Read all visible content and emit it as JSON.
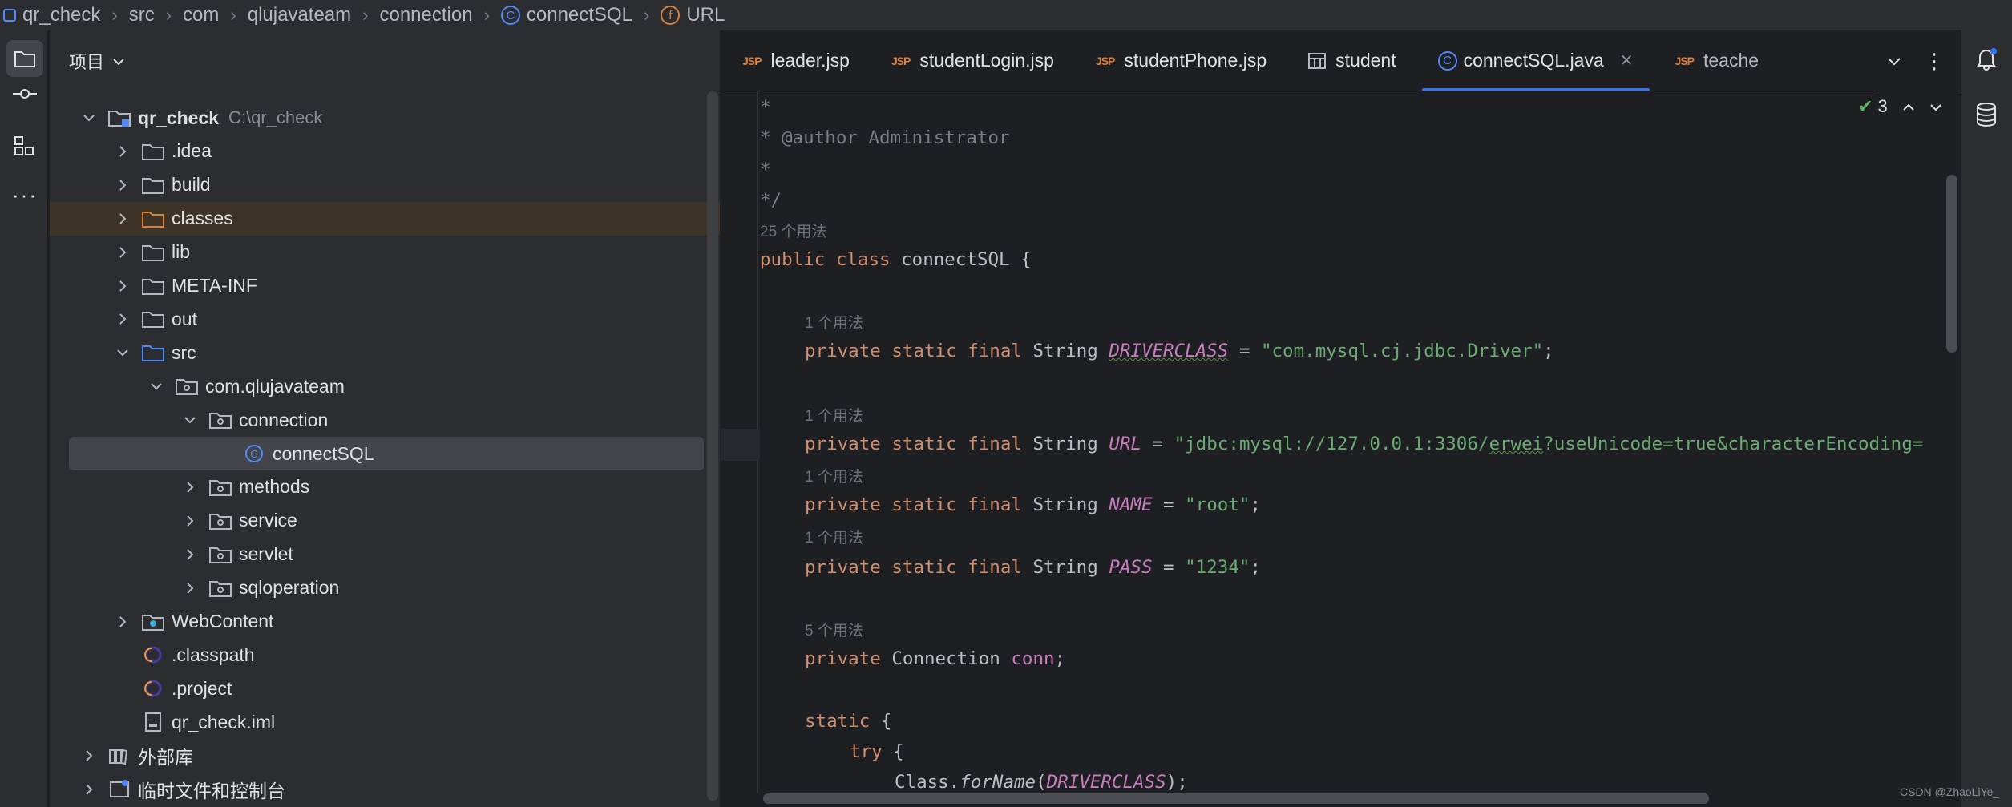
{
  "breadcrumb": [
    "qr_check",
    "src",
    "com",
    "qlujavateam",
    "connection",
    "connectSQL",
    "URL"
  ],
  "project_panel": {
    "title": "项目",
    "tree": [
      {
        "label": "qr_check",
        "sub": "C:\\qr_check",
        "depth": 0,
        "arrow": "down",
        "icon": "module-folder",
        "bold": true
      },
      {
        "label": ".idea",
        "depth": 1,
        "arrow": "right",
        "icon": "folder"
      },
      {
        "label": "build",
        "depth": 1,
        "arrow": "right",
        "icon": "folder"
      },
      {
        "label": "classes",
        "depth": 1,
        "arrow": "right",
        "icon": "folder-orange",
        "highlight": true
      },
      {
        "label": "lib",
        "depth": 1,
        "arrow": "right",
        "icon": "folder"
      },
      {
        "label": "META-INF",
        "depth": 1,
        "arrow": "right",
        "icon": "folder"
      },
      {
        "label": "out",
        "depth": 1,
        "arrow": "right",
        "icon": "folder"
      },
      {
        "label": "src",
        "depth": 1,
        "arrow": "down",
        "icon": "folder-blue"
      },
      {
        "label": "com.qlujavateam",
        "depth": 2,
        "arrow": "down",
        "icon": "package"
      },
      {
        "label": "connection",
        "depth": 3,
        "arrow": "down",
        "icon": "package"
      },
      {
        "label": "connectSQL",
        "depth": 4,
        "arrow": "none",
        "icon": "class",
        "selected": true
      },
      {
        "label": "methods",
        "depth": 3,
        "arrow": "right",
        "icon": "package"
      },
      {
        "label": "service",
        "depth": 3,
        "arrow": "right",
        "icon": "package"
      },
      {
        "label": "servlet",
        "depth": 3,
        "arrow": "right",
        "icon": "package"
      },
      {
        "label": "sqloperation",
        "depth": 3,
        "arrow": "right",
        "icon": "package"
      },
      {
        "label": "WebContent",
        "depth": 1,
        "arrow": "right",
        "icon": "web-folder"
      },
      {
        "label": ".classpath",
        "depth": 1,
        "arrow": "none",
        "icon": "eclipse"
      },
      {
        "label": ".project",
        "depth": 1,
        "arrow": "none",
        "icon": "eclipse"
      },
      {
        "label": "qr_check.iml",
        "depth": 1,
        "arrow": "none",
        "icon": "iml"
      },
      {
        "label": "外部库",
        "depth": 0,
        "arrow": "right",
        "icon": "library"
      },
      {
        "label": "临时文件和控制台",
        "depth": 0,
        "arrow": "right",
        "icon": "scratch"
      }
    ]
  },
  "tabs": [
    {
      "label": "leader.jsp",
      "icon": "JSP"
    },
    {
      "label": "studentLogin.jsp",
      "icon": "JSP"
    },
    {
      "label": "studentPhone.jsp",
      "icon": "JSP"
    },
    {
      "label": "student",
      "icon": "table"
    },
    {
      "label": "connectSQL.java",
      "icon": "class",
      "active": true
    },
    {
      "label": "teache",
      "icon": "JSP"
    }
  ],
  "inspection_count": "3",
  "code": {
    "l1": "*",
    "l2": "* @author Administrator",
    "l3": "*",
    "l4": "*/",
    "usage_25": "25 个用法",
    "usage_1": "1 个用法",
    "usage_5": "5 个用法",
    "class_kw1": "public",
    "class_kw2": "class",
    "class_name": "connectSQL {",
    "mods": "private static final",
    "type": "String",
    "c_driver": "DRIVERCLASS",
    "v_driver": "\"com.mysql.cj.jdbc.Driver\"",
    "c_url": "URL",
    "v_url_a": "\"jdbc:mysql://127.0.0.1:3306/",
    "v_url_b": "erwei",
    "v_url_c": "?useUnicode=true&characterEncoding=",
    "c_name": "NAME",
    "v_name": "\"root\"",
    "c_pass": "PASS",
    "v_pass": "\"1234\"",
    "eq": " = ",
    "semi": ";",
    "private": "private",
    "conn_type": "Connection",
    "conn_field": "conn",
    "static_kw": "static",
    "brace_open": " {",
    "try_kw": "try",
    "class_call": "Class.",
    "forname": "forName",
    "paren_open": "(",
    "paren_close": ");"
  },
  "watermark": "CSDN @ZhaoLiYe_"
}
